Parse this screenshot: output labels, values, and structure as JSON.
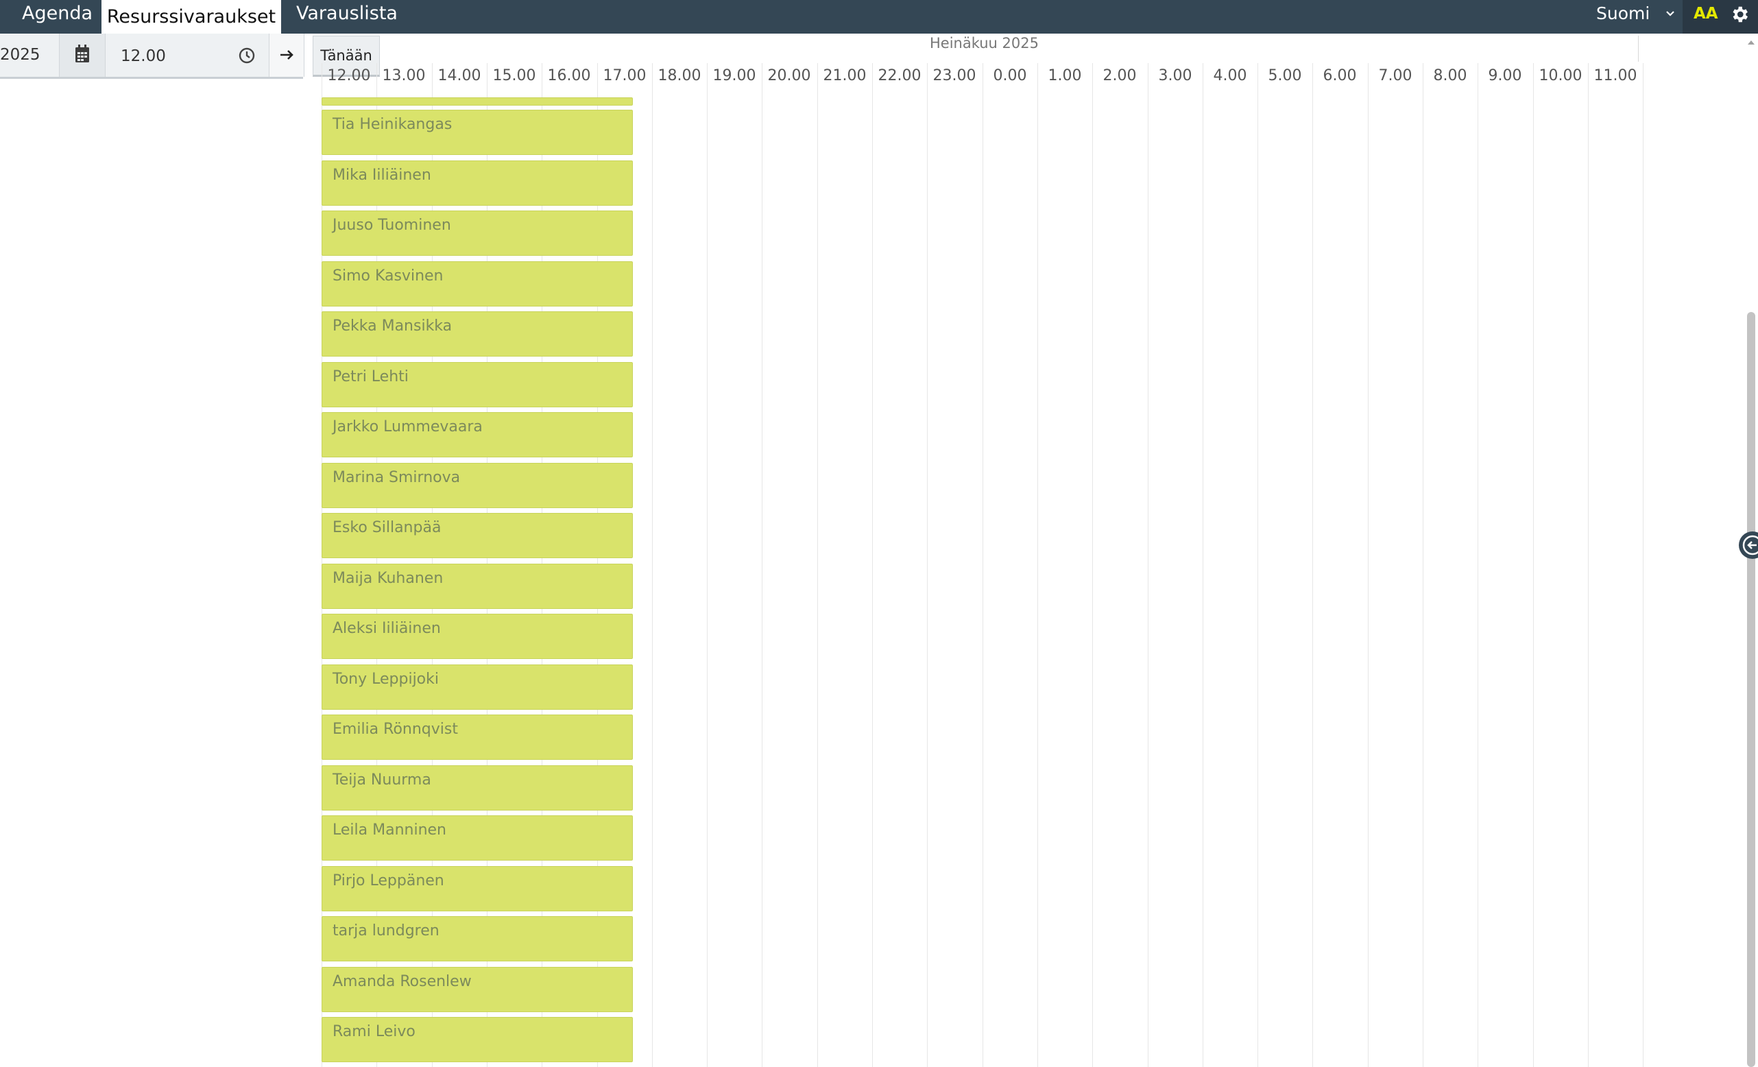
{
  "nav": {
    "tabs": [
      {
        "label": "Agenda",
        "active": false
      },
      {
        "label": "Resurssivaraukset",
        "active": true
      },
      {
        "label": "Varauslista",
        "active": false
      }
    ],
    "language": "Suomi",
    "font_size_label": "AA",
    "accent_color": "#e4e800",
    "bar_color": "#344755"
  },
  "toolbar": {
    "date_value": "2025",
    "time_value": "12.00",
    "today_label": "Tänään"
  },
  "timeline": {
    "month_label": "Heinäkuu 2025",
    "hours": [
      "12.00",
      "13.00",
      "14.00",
      "15.00",
      "16.00",
      "17.00",
      "18.00",
      "19.00",
      "20.00",
      "21.00",
      "22.00",
      "23.00",
      "0.00",
      "1.00",
      "2.00",
      "3.00",
      "4.00",
      "5.00",
      "6.00",
      "7.00",
      "8.00",
      "9.00",
      "10.00",
      "11.00"
    ],
    "booking_color": "#d9e36b",
    "bookings": [
      "Tia Heinikangas",
      "Mika Iiliäinen",
      "Juuso Tuominen",
      "Simo Kasvinen",
      "Pekka Mansikka",
      "Petri Lehti",
      "Jarkko Lummevaara",
      "Marina Smirnova",
      "Esko Sillanpää",
      "Maija Kuhanen",
      "Aleksi Iiliäinen",
      "Tony Leppijoki",
      "Emilia Rönnqvist",
      "Teija Nuurma",
      "Leila Manninen",
      "Pirjo Leppänen",
      "tarja lundgren",
      "Amanda Rosenlew",
      "Rami Leivo"
    ]
  },
  "icons": {
    "calendar": "calendar-icon",
    "clock": "clock-icon",
    "arrow": "arrow-right-icon",
    "gear": "gear-icon",
    "chevron": "chevron-down-icon",
    "side_toggle": "arrow-left-circle-icon"
  }
}
